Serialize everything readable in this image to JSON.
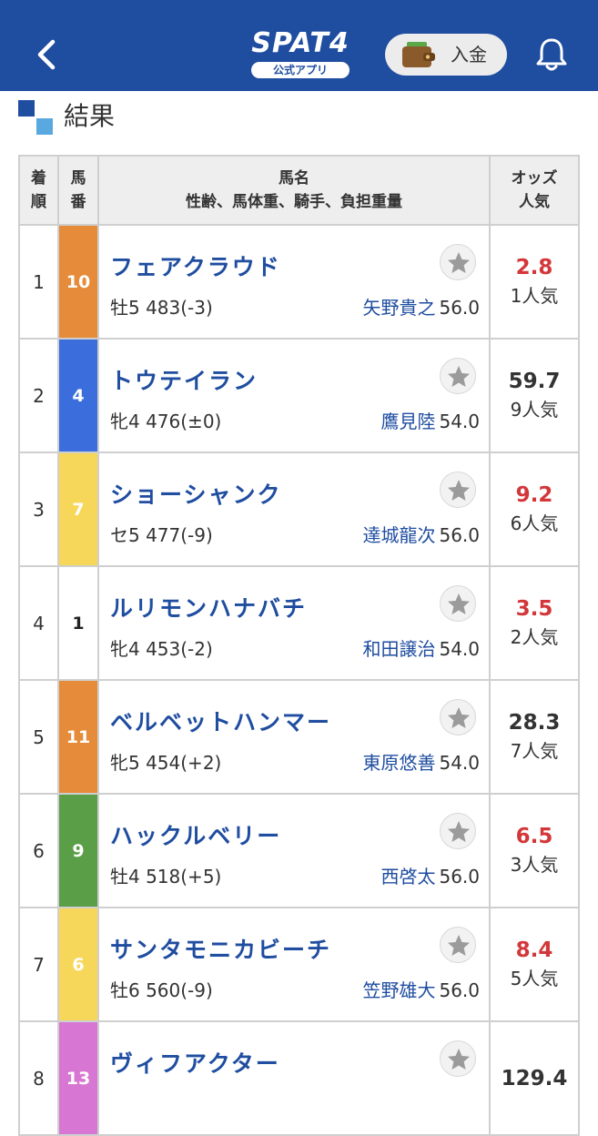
{
  "header": {
    "logo": "SPAT4",
    "logo_sub": "公式アプリ",
    "deposit_label": "入金"
  },
  "section": {
    "title": "結果"
  },
  "table": {
    "headers": {
      "rank": "着順",
      "number": "馬番",
      "name_line1": "馬名",
      "name_line2": "性齢、馬体重、騎手、負担重量",
      "odds_line1": "オッズ",
      "odds_line2": "人気"
    },
    "rows": [
      {
        "rank": "1",
        "number": "10",
        "color": "#e58b3a",
        "name": "フェアクラウド",
        "detail": "牡5 483(-3)",
        "jockey": "矢野貴之",
        "weight": "56.0",
        "odds": "2.8",
        "popularity": "1人気",
        "odds_highlight": true
      },
      {
        "rank": "2",
        "number": "4",
        "color": "#3b6edc",
        "name": "トウテイラン",
        "detail": "牝4 476(±0)",
        "jockey": "鷹見陸",
        "weight": "54.0",
        "odds": "59.7",
        "popularity": "9人気",
        "odds_highlight": false
      },
      {
        "rank": "3",
        "number": "7",
        "color": "#f7d75a",
        "name": "ショーシャンク",
        "detail": "セ5 477(-9)",
        "jockey": "達城龍次",
        "weight": "56.0",
        "odds": "9.2",
        "popularity": "6人気",
        "odds_highlight": true
      },
      {
        "rank": "4",
        "number": "1",
        "color": "#ffffff",
        "name": "ルリモンハナバチ",
        "detail": "牝4 453(-2)",
        "jockey": "和田譲治",
        "weight": "54.0",
        "odds": "3.5",
        "popularity": "2人気",
        "odds_highlight": true
      },
      {
        "rank": "5",
        "number": "11",
        "color": "#e58b3a",
        "name": "ベルベットハンマー",
        "detail": "牝5 454(+2)",
        "jockey": "東原悠善",
        "weight": "54.0",
        "odds": "28.3",
        "popularity": "7人気",
        "odds_highlight": false
      },
      {
        "rank": "6",
        "number": "9",
        "color": "#5a9e47",
        "name": "ハックルベリー",
        "detail": "牡4 518(+5)",
        "jockey": "西啓太",
        "weight": "56.0",
        "odds": "6.5",
        "popularity": "3人気",
        "odds_highlight": true
      },
      {
        "rank": "7",
        "number": "6",
        "color": "#f7d75a",
        "name": "サンタモニカビーチ",
        "detail": "牡6 560(-9)",
        "jockey": "笠野雄大",
        "weight": "56.0",
        "odds": "8.4",
        "popularity": "5人気",
        "odds_highlight": true
      },
      {
        "rank": "8",
        "number": "13",
        "color": "#d877d3",
        "name": "ヴィフアクター",
        "detail": "",
        "jockey": "",
        "weight": "",
        "odds": "129.4",
        "popularity": "",
        "odds_highlight": false
      }
    ]
  },
  "colors": {
    "header_bg": "#1f4da0",
    "link_blue": "#1f4da0",
    "odds_red": "#d3373a"
  }
}
